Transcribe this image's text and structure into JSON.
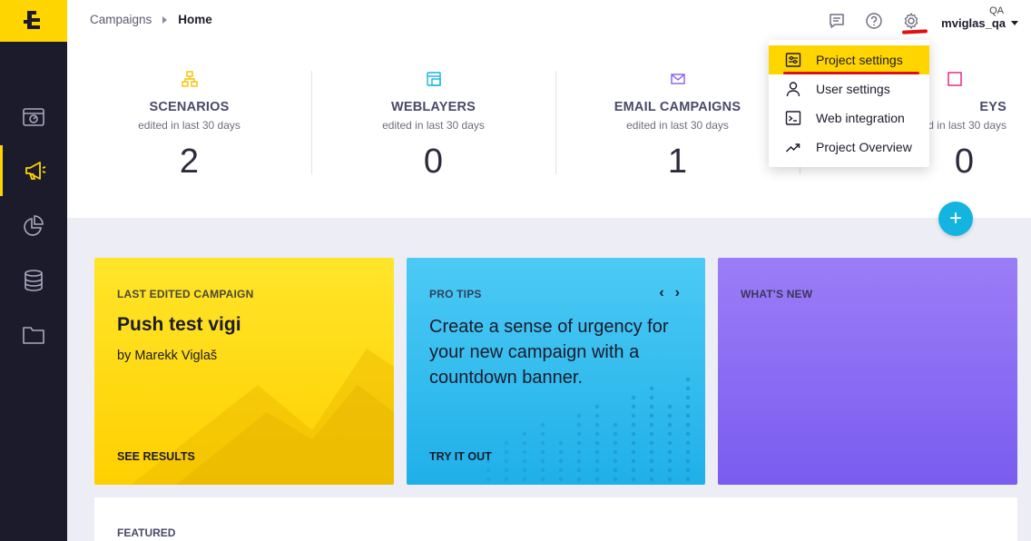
{
  "app": {
    "logo_text": "E",
    "brand_color": "#ffd500"
  },
  "breadcrumb": {
    "parent": "Campaigns",
    "current": "Home"
  },
  "header": {
    "icons": [
      "chat-icon",
      "help-icon",
      "gear-icon"
    ],
    "project": "QA",
    "username": "mviglas_qa"
  },
  "sidebar": {
    "items": [
      {
        "name": "dashboard",
        "icon": "dashboard-icon"
      },
      {
        "name": "campaigns",
        "icon": "megaphone-icon",
        "active": true
      },
      {
        "name": "analyses",
        "icon": "pie-chart-icon"
      },
      {
        "name": "data",
        "icon": "database-icon"
      },
      {
        "name": "assets",
        "icon": "folder-icon"
      }
    ]
  },
  "stats": [
    {
      "title": "SCENARIOS",
      "subtitle": "edited in last 30 days",
      "value": "2",
      "icon": "scenario-icon"
    },
    {
      "title": "WEBLAYERS",
      "subtitle": "edited in last 30 days",
      "value": "0",
      "icon": "weblayer-icon"
    },
    {
      "title": "EMAIL CAMPAIGNS",
      "subtitle": "edited in last 30 days",
      "value": "1",
      "icon": "email-icon"
    },
    {
      "title": "EYS",
      "subtitle": "edited in last 30 days",
      "value": "0",
      "icon": "survey-icon"
    }
  ],
  "fab": {
    "label": "+"
  },
  "cards": {
    "last_edited": {
      "label": "LAST EDITED CAMPAIGN",
      "title": "Push test vigi",
      "author": "by Marekk Viglaš",
      "action": "SEE RESULTS"
    },
    "pro_tips": {
      "label": "PRO TIPS",
      "text": "Create a sense of urgency for your new campaign with a countdown banner.",
      "action": "TRY IT OUT",
      "prev": "‹",
      "next": "›"
    },
    "whats_new": {
      "label": "WHAT'S NEW"
    }
  },
  "featured": {
    "label": "FEATURED"
  },
  "settings_menu": {
    "items": [
      {
        "label": "Project settings",
        "icon": "sliders-icon",
        "selected": true
      },
      {
        "label": "User settings",
        "icon": "user-icon"
      },
      {
        "label": "Web integration",
        "icon": "terminal-icon"
      },
      {
        "label": "Project Overview",
        "icon": "trend-icon"
      }
    ]
  }
}
